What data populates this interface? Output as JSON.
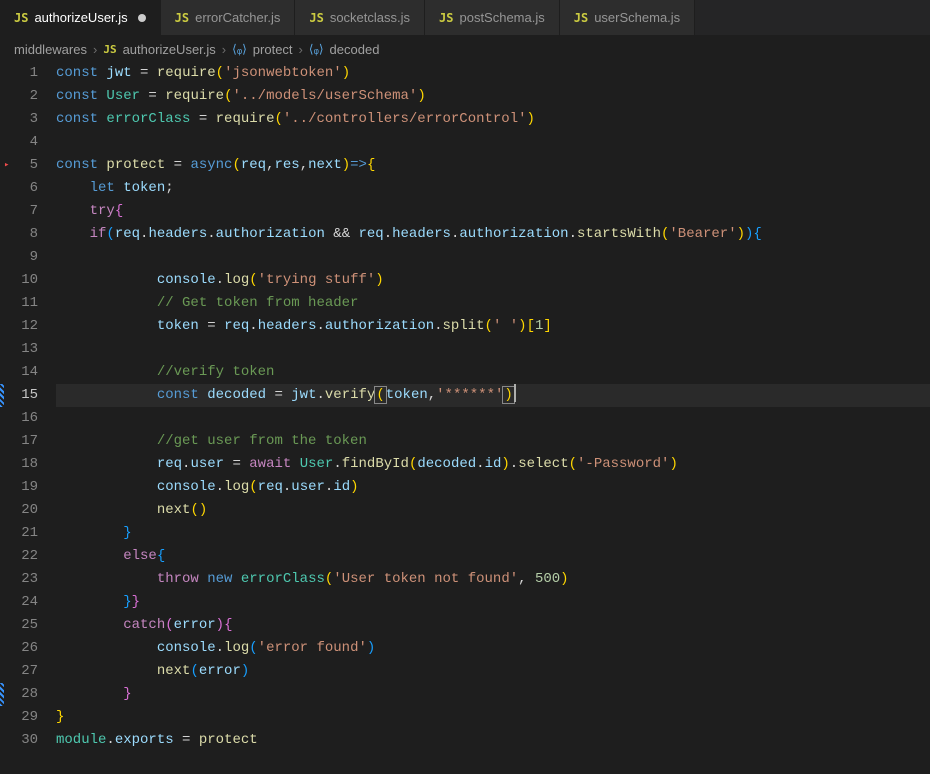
{
  "tabs": [
    {
      "icon": "JS",
      "label": "authorizeUser.js",
      "active": true,
      "modified": true
    },
    {
      "icon": "JS",
      "label": "errorCatcher.js",
      "active": false,
      "modified": false
    },
    {
      "icon": "JS",
      "label": "socketclass.js",
      "active": false,
      "modified": false
    },
    {
      "icon": "JS",
      "label": "postSchema.js",
      "active": false,
      "modified": false
    },
    {
      "icon": "JS",
      "label": "userSchema.js",
      "active": false,
      "modified": false
    }
  ],
  "breadcrumbs": {
    "folder": "middlewares",
    "fileIcon": "JS",
    "file": "authorizeUser.js",
    "sym1": "protect",
    "sym2": "decoded"
  },
  "code": {
    "activeLine": 15,
    "lines": [
      {
        "n": 1,
        "t": [
          [
            "k-blue",
            "const "
          ],
          [
            "var",
            "jwt"
          ],
          [
            "op",
            " = "
          ],
          [
            "fn",
            "require"
          ],
          [
            "br1",
            "("
          ],
          [
            "str",
            "'jsonwebtoken'"
          ],
          [
            "br1",
            ")"
          ]
        ]
      },
      {
        "n": 2,
        "t": [
          [
            "k-blue",
            "const "
          ],
          [
            "cls",
            "User"
          ],
          [
            "op",
            " = "
          ],
          [
            "fn",
            "require"
          ],
          [
            "br1",
            "("
          ],
          [
            "str",
            "'../models/userSchema'"
          ],
          [
            "br1",
            ")"
          ]
        ]
      },
      {
        "n": 3,
        "t": [
          [
            "k-blue",
            "const "
          ],
          [
            "cls",
            "errorClass"
          ],
          [
            "op",
            " = "
          ],
          [
            "fn",
            "require"
          ],
          [
            "br1",
            "("
          ],
          [
            "str",
            "'../controllers/errorControl'"
          ],
          [
            "br1",
            ")"
          ]
        ]
      },
      {
        "n": 4,
        "t": []
      },
      {
        "n": 5,
        "rd": true,
        "t": [
          [
            "k-blue",
            "const "
          ],
          [
            "fn",
            "protect"
          ],
          [
            "op",
            " = "
          ],
          [
            "k-blue",
            "async"
          ],
          [
            "br1",
            "("
          ],
          [
            "var",
            "req"
          ],
          [
            "pn",
            ","
          ],
          [
            "var",
            "res"
          ],
          [
            "pn",
            ","
          ],
          [
            "var",
            "next"
          ],
          [
            "br1",
            ")"
          ],
          [
            "k-blue",
            "=>"
          ],
          [
            "br1",
            "{"
          ]
        ]
      },
      {
        "n": 6,
        "t": [
          [
            "pn",
            "    "
          ],
          [
            "k-blue",
            "let "
          ],
          [
            "var",
            "token"
          ],
          [
            "pn",
            ";"
          ]
        ]
      },
      {
        "n": 7,
        "t": [
          [
            "pn",
            "    "
          ],
          [
            "k-purple",
            "try"
          ],
          [
            "br2",
            "{"
          ]
        ]
      },
      {
        "n": 8,
        "t": [
          [
            "pn",
            "    "
          ],
          [
            "k-purple",
            "if"
          ],
          [
            "br3",
            "("
          ],
          [
            "var",
            "req"
          ],
          [
            "pn",
            "."
          ],
          [
            "var",
            "headers"
          ],
          [
            "pn",
            "."
          ],
          [
            "var",
            "authorization"
          ],
          [
            "op",
            " && "
          ],
          [
            "var",
            "req"
          ],
          [
            "pn",
            "."
          ],
          [
            "var",
            "headers"
          ],
          [
            "pn",
            "."
          ],
          [
            "var",
            "authorization"
          ],
          [
            "pn",
            "."
          ],
          [
            "fn",
            "startsWith"
          ],
          [
            "br1",
            "("
          ],
          [
            "str",
            "'Bearer'"
          ],
          [
            "br1",
            ")"
          ],
          [
            "br3",
            ")"
          ],
          [
            "br3",
            "{"
          ]
        ]
      },
      {
        "n": 9,
        "t": []
      },
      {
        "n": 10,
        "t": [
          [
            "pn",
            "            "
          ],
          [
            "var",
            "console"
          ],
          [
            "pn",
            "."
          ],
          [
            "fn",
            "log"
          ],
          [
            "br1",
            "("
          ],
          [
            "str",
            "'trying stuff'"
          ],
          [
            "br1",
            ")"
          ]
        ]
      },
      {
        "n": 11,
        "t": [
          [
            "pn",
            "            "
          ],
          [
            "cmt",
            "// Get token from header"
          ]
        ]
      },
      {
        "n": 12,
        "t": [
          [
            "pn",
            "            "
          ],
          [
            "var",
            "token"
          ],
          [
            "op",
            " = "
          ],
          [
            "var",
            "req"
          ],
          [
            "pn",
            "."
          ],
          [
            "var",
            "headers"
          ],
          [
            "pn",
            "."
          ],
          [
            "var",
            "authorization"
          ],
          [
            "pn",
            "."
          ],
          [
            "fn",
            "split"
          ],
          [
            "br1",
            "("
          ],
          [
            "str",
            "' '"
          ],
          [
            "br1",
            ")"
          ],
          [
            "br1",
            "["
          ],
          [
            "num",
            "1"
          ],
          [
            "br1",
            "]"
          ]
        ]
      },
      {
        "n": 13,
        "t": []
      },
      {
        "n": 14,
        "t": [
          [
            "pn",
            "            "
          ],
          [
            "cmt",
            "//verify token"
          ]
        ]
      },
      {
        "n": 15,
        "hl": true,
        "mark": true,
        "cursor": true,
        "t": [
          [
            "pn",
            "            "
          ],
          [
            "k-blue",
            "const "
          ],
          [
            "var",
            "decoded"
          ],
          [
            "op",
            " = "
          ],
          [
            "var",
            "jwt"
          ],
          [
            "pn",
            "."
          ],
          [
            "fn",
            "verify"
          ],
          [
            "br1 cursor-box",
            "("
          ],
          [
            "var",
            "token"
          ],
          [
            "pn",
            ","
          ],
          [
            "str",
            "'******'"
          ],
          [
            "br1 cursor-box",
            ")"
          ]
        ]
      },
      {
        "n": 16,
        "t": []
      },
      {
        "n": 17,
        "t": [
          [
            "pn",
            "            "
          ],
          [
            "cmt",
            "//get user from the token"
          ]
        ]
      },
      {
        "n": 18,
        "t": [
          [
            "pn",
            "            "
          ],
          [
            "var",
            "req"
          ],
          [
            "pn",
            "."
          ],
          [
            "var",
            "user"
          ],
          [
            "op",
            " = "
          ],
          [
            "k-purple",
            "await "
          ],
          [
            "cls",
            "User"
          ],
          [
            "pn",
            "."
          ],
          [
            "fn",
            "findById"
          ],
          [
            "br1",
            "("
          ],
          [
            "var",
            "decoded"
          ],
          [
            "pn",
            "."
          ],
          [
            "var",
            "id"
          ],
          [
            "br1",
            ")"
          ],
          [
            "pn",
            "."
          ],
          [
            "fn",
            "select"
          ],
          [
            "br1",
            "("
          ],
          [
            "str",
            "'-Password'"
          ],
          [
            "br1",
            ")"
          ]
        ]
      },
      {
        "n": 19,
        "t": [
          [
            "pn",
            "            "
          ],
          [
            "var",
            "console"
          ],
          [
            "pn",
            "."
          ],
          [
            "fn",
            "log"
          ],
          [
            "br1",
            "("
          ],
          [
            "var",
            "req"
          ],
          [
            "pn",
            "."
          ],
          [
            "var",
            "user"
          ],
          [
            "pn",
            "."
          ],
          [
            "var",
            "id"
          ],
          [
            "br1",
            ")"
          ]
        ]
      },
      {
        "n": 20,
        "t": [
          [
            "pn",
            "            "
          ],
          [
            "fn",
            "next"
          ],
          [
            "br1",
            "("
          ],
          [
            "br1",
            ")"
          ]
        ]
      },
      {
        "n": 21,
        "t": [
          [
            "pn",
            "        "
          ],
          [
            "br3",
            "}"
          ]
        ]
      },
      {
        "n": 22,
        "t": [
          [
            "pn",
            "        "
          ],
          [
            "k-purple",
            "else"
          ],
          [
            "br3",
            "{"
          ]
        ]
      },
      {
        "n": 23,
        "t": [
          [
            "pn",
            "            "
          ],
          [
            "k-purple",
            "throw"
          ],
          [
            "pn",
            " "
          ],
          [
            "k-blue",
            "new"
          ],
          [
            "pn",
            " "
          ],
          [
            "cls",
            "errorClass"
          ],
          [
            "br1",
            "("
          ],
          [
            "str",
            "'User token not found'"
          ],
          [
            "pn",
            ", "
          ],
          [
            "num",
            "500"
          ],
          [
            "br1",
            ")"
          ]
        ]
      },
      {
        "n": 24,
        "t": [
          [
            "pn",
            "        "
          ],
          [
            "br3",
            "}"
          ],
          [
            "br2",
            "}"
          ]
        ]
      },
      {
        "n": 25,
        "t": [
          [
            "pn",
            "        "
          ],
          [
            "k-purple",
            "catch"
          ],
          [
            "br2",
            "("
          ],
          [
            "var",
            "error"
          ],
          [
            "br2",
            ")"
          ],
          [
            "br2",
            "{"
          ]
        ]
      },
      {
        "n": 26,
        "t": [
          [
            "pn",
            "            "
          ],
          [
            "var",
            "console"
          ],
          [
            "pn",
            "."
          ],
          [
            "fn",
            "log"
          ],
          [
            "br3",
            "("
          ],
          [
            "str",
            "'error found'"
          ],
          [
            "br3",
            ")"
          ]
        ]
      },
      {
        "n": 27,
        "t": [
          [
            "pn",
            "            "
          ],
          [
            "fn",
            "next"
          ],
          [
            "br3",
            "("
          ],
          [
            "var",
            "error"
          ],
          [
            "br3",
            ")"
          ]
        ]
      },
      {
        "n": 28,
        "mark": true,
        "t": [
          [
            "pn",
            "        "
          ],
          [
            "br2",
            "}"
          ]
        ]
      },
      {
        "n": 29,
        "t": [
          [
            "br1",
            "}"
          ]
        ]
      },
      {
        "n": 30,
        "t": [
          [
            "cls",
            "module"
          ],
          [
            "pn",
            "."
          ],
          [
            "var",
            "exports"
          ],
          [
            "op",
            " = "
          ],
          [
            "fn",
            "protect"
          ]
        ]
      }
    ]
  }
}
